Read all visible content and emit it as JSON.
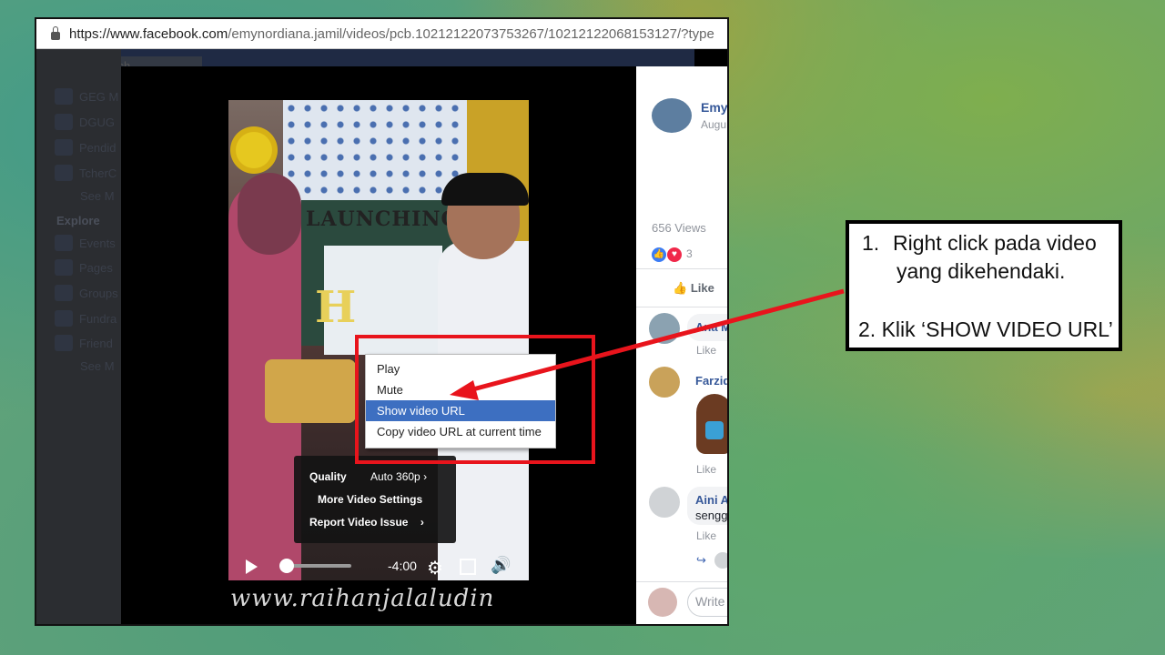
{
  "browser": {
    "url_host": "https://www.facebook.com",
    "url_rest": "/emynordiana.jamil/videos/pcb.10212122073753267/10212122068153127/?type"
  },
  "fb": {
    "search_placeholder": "Search",
    "sidebar": [
      {
        "label": "GEG M"
      },
      {
        "label": "DGUG"
      },
      {
        "label": "Pendid"
      },
      {
        "label": "TcherC"
      },
      {
        "label": "See M"
      }
    ],
    "explore_heading": "Explore",
    "explore_items": [
      {
        "label": "Events"
      },
      {
        "label": "Pages"
      },
      {
        "label": "Groups"
      },
      {
        "label": "Fundra"
      },
      {
        "label": "Friend"
      },
      {
        "label": "See M"
      }
    ]
  },
  "video": {
    "banner_text": "LAUNCHING",
    "letter": "H",
    "settings": {
      "quality_label": "Quality",
      "quality_value": "Auto 360p",
      "more_settings": "More Video Settings",
      "report_issue": "Report Video Issue"
    },
    "time_remaining": "-4:00",
    "progress_fraction": 0.05,
    "watermark": "www.raihanjalaludin"
  },
  "context_menu": {
    "items": [
      {
        "label": "Play"
      },
      {
        "label": "Mute"
      },
      {
        "label": "Show video URL",
        "selected": true
      },
      {
        "label": "Copy video URL at current time"
      }
    ],
    "highlight_color": "#3d6fc1"
  },
  "post_panel": {
    "author_name": "Emy",
    "post_date": "Augu",
    "views": "656 Views",
    "reaction_count": "3",
    "like_button": "Like",
    "comments": [
      {
        "name": "Ana M",
        "like": "Like"
      },
      {
        "name": "Farzid",
        "like": "Like"
      },
      {
        "name": "Aini A",
        "text": "sengg",
        "like": "Like"
      }
    ],
    "write_placeholder": "Write"
  },
  "instructions": {
    "step1_num": "1.",
    "step1_line1": "Right click pada video",
    "step1_line2": "yang dikehendaki.",
    "step2": "2. Klik ‘SHOW VIDEO URL’"
  },
  "colors": {
    "highlight_border": "#e8141c",
    "fb_blue": "#365899"
  }
}
